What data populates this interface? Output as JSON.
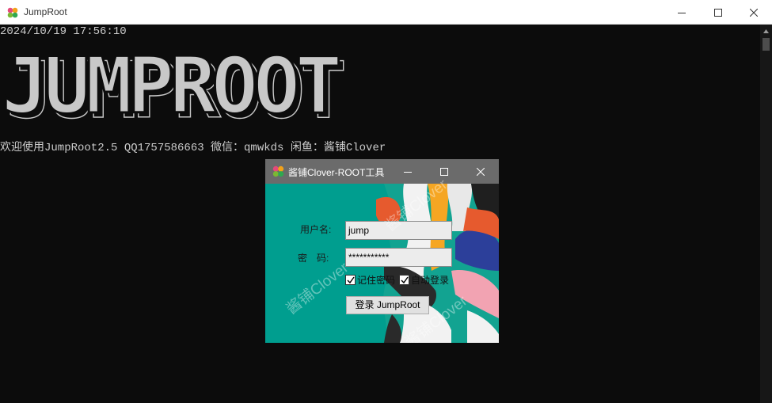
{
  "window": {
    "title": "JumpRoot"
  },
  "console": {
    "timestamp": "2024/10/19 17:56:10",
    "banner": "JUMPROOT",
    "welcome": "欢迎使用JumpRoot2.5 QQ1757586663 微信：qmwkds 闲鱼：酱铺Clover"
  },
  "dialog": {
    "title": "酱铺Clover-ROOT工具",
    "username_label": "用户名:",
    "username_value": "jump",
    "password_label": "密　码:",
    "password_value": "***********",
    "remember_label": "记住密码",
    "remember_checked": true,
    "autologin_label": "自动登录",
    "autologin_checked": true,
    "login_button": "登录 JumpRoot",
    "watermark": "酱铺Clover"
  },
  "colors": {
    "console_bg": "#0c0c0c",
    "console_text": "#cccccc",
    "dialog_bg": "#009e8f",
    "dialog_titlebar": "#6b6b6b"
  }
}
